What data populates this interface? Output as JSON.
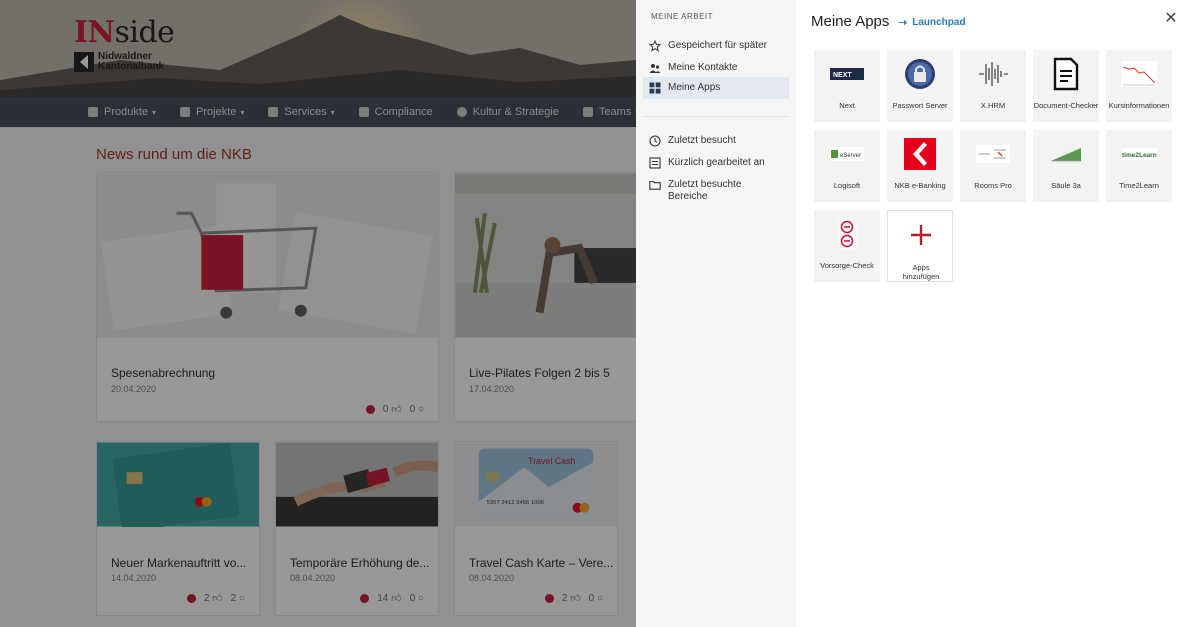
{
  "logo": {
    "title_red": "IN",
    "title_rest": "side",
    "bank_line1": "Nidwaldner",
    "bank_line2": "Kantonalbank"
  },
  "nav": [
    {
      "label": "Produkte",
      "icon": "document-icon",
      "caret": true
    },
    {
      "label": "Projekte",
      "icon": "wrench-icon",
      "caret": true
    },
    {
      "label": "Services",
      "icon": "car-icon",
      "caret": true
    },
    {
      "label": "Compliance",
      "icon": "card-icon",
      "caret": false
    },
    {
      "label": "Kultur & Strategie",
      "icon": "globe-icon",
      "caret": false
    },
    {
      "label": "Teams",
      "icon": "people-icon",
      "caret": true
    }
  ],
  "news": {
    "title": "News rund um die NKB",
    "cards": [
      {
        "title": "Spesenabrechnung",
        "date": "20.04.2020",
        "likes": "0",
        "comments": "0"
      },
      {
        "title": "Live-Pilates Folgen 2 bis 5",
        "date": "17.04.2020"
      },
      {
        "title": "Neuer Markenauftritt vo...",
        "date": "14.04.2020",
        "likes": "2",
        "comments": "2"
      },
      {
        "title": "Temporäre Erhöhung de...",
        "date": "08.04.2020",
        "likes": "14",
        "comments": "0"
      },
      {
        "title": "Travel Cash Karte – Vere...",
        "date": "08.04.2020",
        "likes": "2",
        "comments": "0"
      }
    ],
    "travel_card_text": "Travel Cash",
    "card_number": "5307 2412 3456 1006"
  },
  "panel": {
    "section_head": "MEINE ARBEIT",
    "items": [
      {
        "label": "Gespeichert für später",
        "icon": "star-icon"
      },
      {
        "label": "Meine Kontakte",
        "icon": "contacts-icon"
      },
      {
        "label": "Meine Apps",
        "icon": "apps-grid-icon",
        "active": true
      }
    ],
    "items2": [
      {
        "label": "Zuletzt besucht",
        "icon": "clock-icon"
      },
      {
        "label": "Kürzlich gearbeitet an",
        "icon": "doc-list-icon"
      },
      {
        "label": "Zuletzt besuchte Bereiche",
        "icon": "folder-icon"
      }
    ],
    "title": "Meine Apps",
    "link": "Launchpad",
    "apps": [
      {
        "label": "Next",
        "icon": "next-logo-icon"
      },
      {
        "label": "Passwort Server",
        "icon": "password-lock-icon"
      },
      {
        "label": "X.HRM",
        "icon": "xhrm-logo-icon"
      },
      {
        "label": "Document-Checker",
        "icon": "document-icon"
      },
      {
        "label": "Kursinformationen",
        "icon": "chart-line-icon"
      },
      {
        "label": "Logisoft",
        "icon": "logisoft-logo-icon"
      },
      {
        "label": "NKB e-Banking",
        "icon": "nkb-logo-icon"
      },
      {
        "label": "Rooms Pro",
        "icon": "rooms-logo-icon"
      },
      {
        "label": "Säule 3a",
        "icon": "saeule-logo-icon"
      },
      {
        "label": "Time2Learn",
        "icon": "time2learn-logo-icon"
      },
      {
        "label": "Vorsorge-Check",
        "icon": "vorsorge-icon"
      },
      {
        "label": "Apps hinzufügen",
        "icon": "plus-icon"
      }
    ],
    "next_logo_text": "NEXT",
    "logisoft_logo_text": "eServer",
    "time2learn_logo_text": "time2Learn"
  },
  "colors": {
    "brand_red": "#c8102e",
    "nav_bg": "#3d4450",
    "link_blue": "#2a7ab8"
  }
}
